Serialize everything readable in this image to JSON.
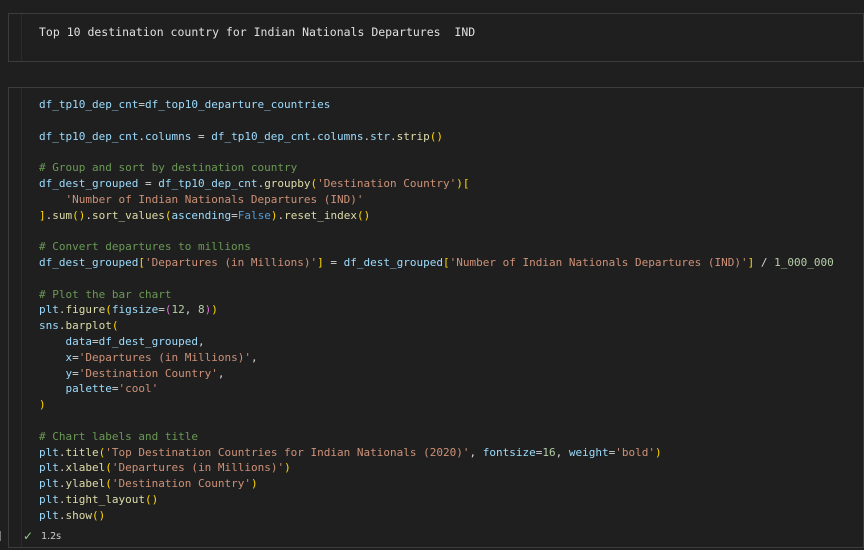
{
  "markdown_cell": {
    "text": "Top 10 destination country for Indian Nationals Departures  IND"
  },
  "code_cell": {
    "status_time": "1.2s",
    "lines": [
      [
        {
          "t": "df_tp10_dep_cnt",
          "c": "v"
        },
        {
          "t": "=",
          "c": "o"
        },
        {
          "t": "df_top10_departure_countries",
          "c": "v"
        }
      ],
      [],
      [
        {
          "t": "df_tp10_dep_cnt",
          "c": "v"
        },
        {
          "t": ".",
          "c": "o"
        },
        {
          "t": "columns",
          "c": "v"
        },
        {
          "t": " = ",
          "c": "o"
        },
        {
          "t": "df_tp10_dep_cnt",
          "c": "v"
        },
        {
          "t": ".",
          "c": "o"
        },
        {
          "t": "columns",
          "c": "v"
        },
        {
          "t": ".",
          "c": "o"
        },
        {
          "t": "str",
          "c": "v"
        },
        {
          "t": ".",
          "c": "o"
        },
        {
          "t": "strip",
          "c": "f"
        },
        {
          "t": "()",
          "c": "b1"
        }
      ],
      [],
      [
        {
          "t": "# Group and sort by destination country",
          "c": "c"
        }
      ],
      [
        {
          "t": "df_dest_grouped",
          "c": "v"
        },
        {
          "t": " = ",
          "c": "o"
        },
        {
          "t": "df_tp10_dep_cnt",
          "c": "v"
        },
        {
          "t": ".",
          "c": "o"
        },
        {
          "t": "groupby",
          "c": "f"
        },
        {
          "t": "(",
          "c": "b1"
        },
        {
          "t": "'Destination Country'",
          "c": "s"
        },
        {
          "t": ")",
          "c": "b1"
        },
        {
          "t": "[",
          "c": "b1"
        }
      ],
      [
        {
          "t": "    ",
          "c": "o"
        },
        {
          "t": "'Number of Indian Nationals Departures (IND)'",
          "c": "s"
        }
      ],
      [
        {
          "t": "]",
          "c": "b1"
        },
        {
          "t": ".",
          "c": "o"
        },
        {
          "t": "sum",
          "c": "f"
        },
        {
          "t": "()",
          "c": "b1"
        },
        {
          "t": ".",
          "c": "o"
        },
        {
          "t": "sort_values",
          "c": "f"
        },
        {
          "t": "(",
          "c": "b1"
        },
        {
          "t": "ascending",
          "c": "v"
        },
        {
          "t": "=",
          "c": "o"
        },
        {
          "t": "False",
          "c": "k"
        },
        {
          "t": ")",
          "c": "b1"
        },
        {
          "t": ".",
          "c": "o"
        },
        {
          "t": "reset_index",
          "c": "f"
        },
        {
          "t": "()",
          "c": "b1"
        }
      ],
      [],
      [
        {
          "t": "# Convert departures to millions",
          "c": "c"
        }
      ],
      [
        {
          "t": "df_dest_grouped",
          "c": "v"
        },
        {
          "t": "[",
          "c": "b1"
        },
        {
          "t": "'Departures (in Millions)'",
          "c": "s"
        },
        {
          "t": "]",
          "c": "b1"
        },
        {
          "t": " = ",
          "c": "o"
        },
        {
          "t": "df_dest_grouped",
          "c": "v"
        },
        {
          "t": "[",
          "c": "b1"
        },
        {
          "t": "'Number of Indian Nationals Departures (IND)'",
          "c": "s"
        },
        {
          "t": "]",
          "c": "b1"
        },
        {
          "t": " / ",
          "c": "o"
        },
        {
          "t": "1_000_000",
          "c": "n"
        }
      ],
      [],
      [
        {
          "t": "# Plot the bar chart",
          "c": "c"
        }
      ],
      [
        {
          "t": "plt",
          "c": "v"
        },
        {
          "t": ".",
          "c": "o"
        },
        {
          "t": "figure",
          "c": "f"
        },
        {
          "t": "(",
          "c": "b1"
        },
        {
          "t": "figsize",
          "c": "v"
        },
        {
          "t": "=",
          "c": "o"
        },
        {
          "t": "(",
          "c": "b2"
        },
        {
          "t": "12",
          "c": "n"
        },
        {
          "t": ", ",
          "c": "o"
        },
        {
          "t": "8",
          "c": "n"
        },
        {
          "t": ")",
          "c": "b2"
        },
        {
          "t": ")",
          "c": "b1"
        }
      ],
      [
        {
          "t": "sns",
          "c": "v"
        },
        {
          "t": ".",
          "c": "o"
        },
        {
          "t": "barplot",
          "c": "f"
        },
        {
          "t": "(",
          "c": "b1"
        }
      ],
      [
        {
          "t": "    ",
          "c": "o"
        },
        {
          "t": "data",
          "c": "v"
        },
        {
          "t": "=",
          "c": "o"
        },
        {
          "t": "df_dest_grouped",
          "c": "v"
        },
        {
          "t": ",",
          "c": "o"
        }
      ],
      [
        {
          "t": "    ",
          "c": "o"
        },
        {
          "t": "x",
          "c": "v"
        },
        {
          "t": "=",
          "c": "o"
        },
        {
          "t": "'Departures (in Millions)'",
          "c": "s"
        },
        {
          "t": ",",
          "c": "o"
        }
      ],
      [
        {
          "t": "    ",
          "c": "o"
        },
        {
          "t": "y",
          "c": "v"
        },
        {
          "t": "=",
          "c": "o"
        },
        {
          "t": "'Destination Country'",
          "c": "s"
        },
        {
          "t": ",",
          "c": "o"
        }
      ],
      [
        {
          "t": "    ",
          "c": "o"
        },
        {
          "t": "palette",
          "c": "v"
        },
        {
          "t": "=",
          "c": "o"
        },
        {
          "t": "'cool'",
          "c": "s"
        }
      ],
      [
        {
          "t": ")",
          "c": "b1"
        }
      ],
      [],
      [
        {
          "t": "# Chart labels and title",
          "c": "c"
        }
      ],
      [
        {
          "t": "plt",
          "c": "v"
        },
        {
          "t": ".",
          "c": "o"
        },
        {
          "t": "title",
          "c": "f"
        },
        {
          "t": "(",
          "c": "b1"
        },
        {
          "t": "'Top Destination Countries for Indian Nationals (2020)'",
          "c": "s"
        },
        {
          "t": ", ",
          "c": "o"
        },
        {
          "t": "fontsize",
          "c": "v"
        },
        {
          "t": "=",
          "c": "o"
        },
        {
          "t": "16",
          "c": "n"
        },
        {
          "t": ", ",
          "c": "o"
        },
        {
          "t": "weight",
          "c": "v"
        },
        {
          "t": "=",
          "c": "o"
        },
        {
          "t": "'bold'",
          "c": "s"
        },
        {
          "t": ")",
          "c": "b1"
        }
      ],
      [
        {
          "t": "plt",
          "c": "v"
        },
        {
          "t": ".",
          "c": "o"
        },
        {
          "t": "xlabel",
          "c": "f"
        },
        {
          "t": "(",
          "c": "b1"
        },
        {
          "t": "'Departures (in Millions)'",
          "c": "s"
        },
        {
          "t": ")",
          "c": "b1"
        }
      ],
      [
        {
          "t": "plt",
          "c": "v"
        },
        {
          "t": ".",
          "c": "o"
        },
        {
          "t": "ylabel",
          "c": "f"
        },
        {
          "t": "(",
          "c": "b1"
        },
        {
          "t": "'Destination Country'",
          "c": "s"
        },
        {
          "t": ")",
          "c": "b1"
        }
      ],
      [
        {
          "t": "plt",
          "c": "v"
        },
        {
          "t": ".",
          "c": "o"
        },
        {
          "t": "tight_layout",
          "c": "f"
        },
        {
          "t": "()",
          "c": "b1"
        }
      ],
      [
        {
          "t": "plt",
          "c": "v"
        },
        {
          "t": ".",
          "c": "o"
        },
        {
          "t": "show",
          "c": "f"
        },
        {
          "t": "()",
          "c": "b1"
        }
      ]
    ]
  },
  "colors": {
    "background": "#1f1f1f",
    "cell_border": "#3c3c3c",
    "success_check": "#89d185"
  },
  "icons": {
    "status": "check-icon"
  }
}
